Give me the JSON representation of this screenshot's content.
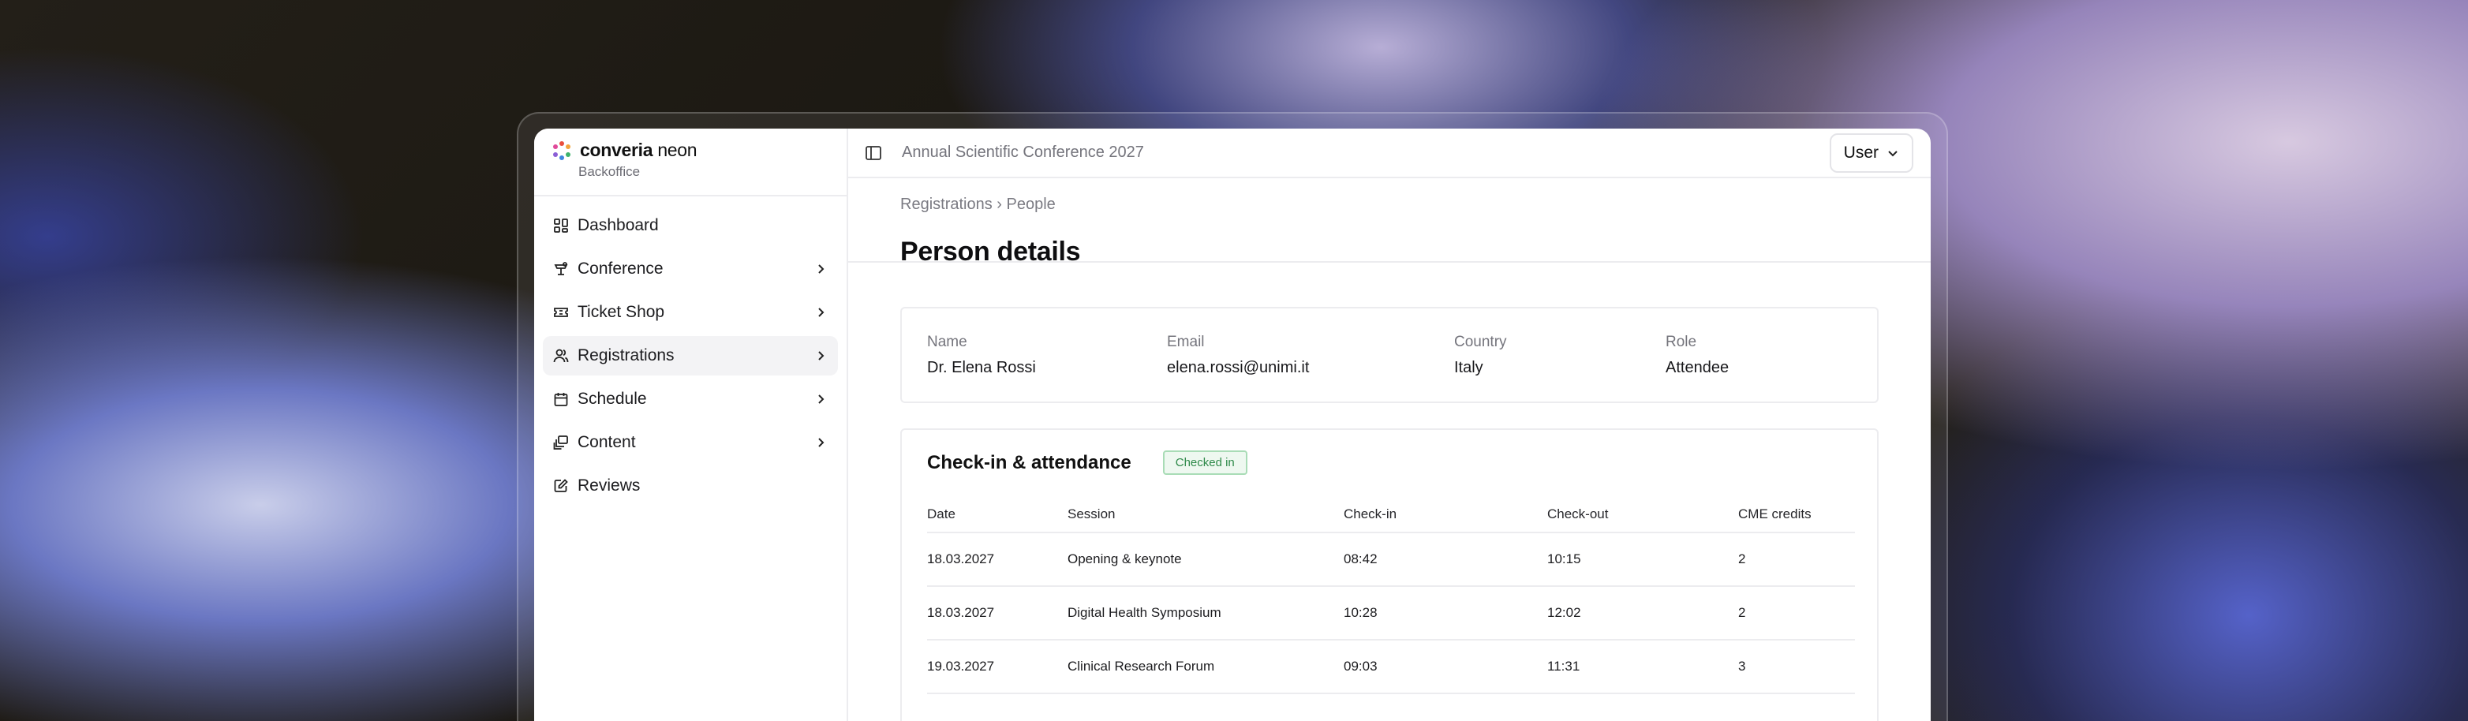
{
  "brand": {
    "name": "converia",
    "name_suffix": "neon",
    "subtitle": "Backoffice"
  },
  "sidebar": {
    "items": [
      {
        "label": "Dashboard",
        "icon": "dashboard-icon",
        "has_children": false,
        "active": false
      },
      {
        "label": "Conference",
        "icon": "conference-icon",
        "has_children": true,
        "active": false
      },
      {
        "label": "Ticket Shop",
        "icon": "ticket-icon",
        "has_children": true,
        "active": false
      },
      {
        "label": "Registrations",
        "icon": "users-icon",
        "has_children": true,
        "active": true
      },
      {
        "label": "Schedule",
        "icon": "calendar-icon",
        "has_children": true,
        "active": false
      },
      {
        "label": "Content",
        "icon": "content-icon",
        "has_children": true,
        "active": false
      },
      {
        "label": "Reviews",
        "icon": "reviews-icon",
        "has_children": false,
        "active": false
      }
    ]
  },
  "topbar": {
    "event_title": "Annual Scientific Conference 2027",
    "user_label": "User"
  },
  "header": {
    "breadcrumb": "Registrations › People",
    "title": "Person details"
  },
  "person": {
    "fields": [
      {
        "label": "Name",
        "value": "Dr. Elena Rossi"
      },
      {
        "label": "Email",
        "value": "elena.rossi@unimi.it"
      },
      {
        "label": "Country",
        "value": "Italy"
      },
      {
        "label": "Role",
        "value": "Attendee"
      }
    ]
  },
  "attendance": {
    "title": "Check-in & attendance",
    "status_badge": "Checked in",
    "columns": [
      "Date",
      "Session",
      "Check-in",
      "Check-out",
      "CME credits"
    ],
    "rows": [
      [
        "18.03.2027",
        "Opening & keynote",
        "08:42",
        "10:15",
        "2"
      ],
      [
        "18.03.2027",
        "Digital Health Symposium",
        "10:28",
        "12:02",
        "2"
      ],
      [
        "19.03.2027",
        "Clinical Research Forum",
        "09:03",
        "11:31",
        "3"
      ]
    ]
  },
  "colors": {
    "badge_green": "#2f8a4a",
    "active_nav_bg": "#f3f3f5"
  }
}
